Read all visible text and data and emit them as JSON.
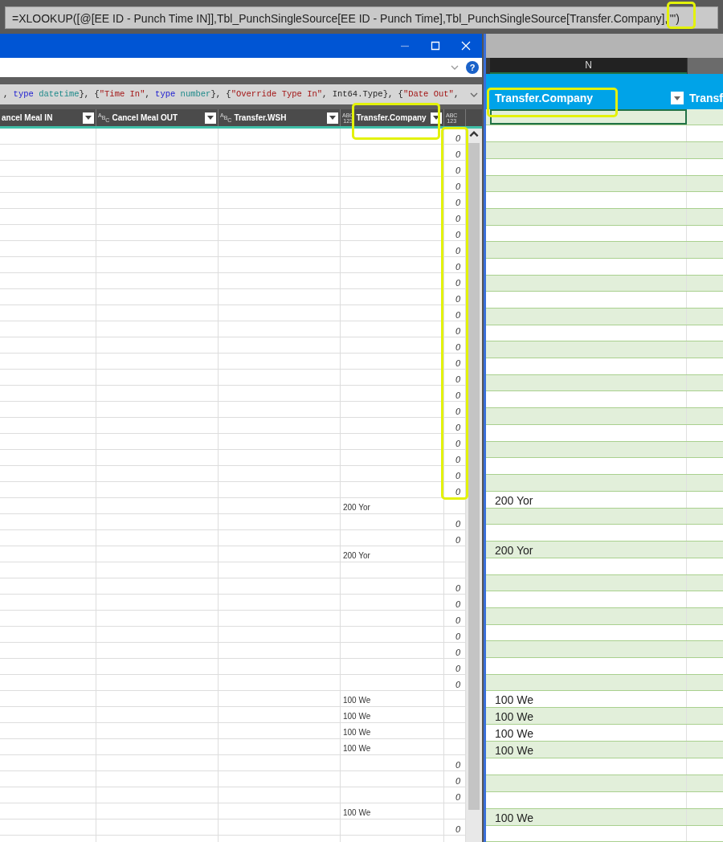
{
  "formula_bar": {
    "text": "=XLOOKUP([@[EE ID - Punch Time IN]],Tbl_PunchSingleSource[EE ID - Punch Time],Tbl_PunchSingleSource[Transfer.Company],\"\")"
  },
  "query_editor": {
    "help_glyph": "?",
    "m_code": [
      {
        "kind": "plain",
        "text": ", "
      },
      {
        "kind": "keyword",
        "text": "type"
      },
      {
        "kind": "typename",
        "text": " datetime"
      },
      {
        "kind": "plain",
        "text": "}, {"
      },
      {
        "kind": "string",
        "text": "\"Time In\""
      },
      {
        "kind": "plain",
        "text": ", "
      },
      {
        "kind": "keyword",
        "text": "type"
      },
      {
        "kind": "typename",
        "text": " number"
      },
      {
        "kind": "plain",
        "text": "}, {"
      },
      {
        "kind": "string",
        "text": "\"Override Type In\""
      },
      {
        "kind": "plain",
        "text": ", Int64.Type}, {"
      },
      {
        "kind": "string",
        "text": "\"Date Out\""
      },
      {
        "kind": "plain",
        "text": ","
      }
    ],
    "columns": [
      {
        "kind": "none",
        "label": "ancel Meal IN"
      },
      {
        "kind": "text",
        "type_icon": [
          "A",
          "B",
          "C"
        ],
        "label": "Cancel Meal OUT"
      },
      {
        "kind": "text",
        "type_icon": [
          "A",
          "B",
          "C"
        ],
        "label": "Transfer.WSH"
      },
      {
        "kind": "any",
        "type_icon": [
          "ABC",
          "123"
        ],
        "label": "Transfer.Company"
      },
      {
        "kind": "any",
        "type_icon": [
          "ABC",
          "123"
        ]
      }
    ],
    "rows": [
      {
        "value": "0"
      },
      {
        "value": "0"
      },
      {
        "value": "0"
      },
      {
        "value": "0"
      },
      {
        "value": "0"
      },
      {
        "value": "0"
      },
      {
        "value": "0"
      },
      {
        "value": "0"
      },
      {
        "value": "0"
      },
      {
        "value": "0"
      },
      {
        "value": "0"
      },
      {
        "value": "0"
      },
      {
        "value": "0"
      },
      {
        "value": "0"
      },
      {
        "value": "0"
      },
      {
        "value": "0"
      },
      {
        "value": "0"
      },
      {
        "value": "0"
      },
      {
        "value": "0"
      },
      {
        "value": "0"
      },
      {
        "value": "0"
      },
      {
        "value": "0"
      },
      {
        "value": "0"
      },
      {
        "company": "200 Yor"
      },
      {
        "value": "0"
      },
      {
        "value": "0"
      },
      {
        "company": "200 Yor"
      },
      {},
      {
        "value": "0"
      },
      {
        "value": "0"
      },
      {
        "value": "0"
      },
      {
        "value": "0"
      },
      {
        "value": "0"
      },
      {
        "value": "0"
      },
      {
        "value": "0"
      },
      {
        "company": "100 We"
      },
      {
        "company": "100 We"
      },
      {
        "company": "100 We"
      },
      {
        "company": "100 We"
      },
      {
        "value": "0"
      },
      {
        "value": "0"
      },
      {
        "value": "0"
      },
      {
        "company": "100 We"
      },
      {
        "value": "0"
      },
      {}
    ]
  },
  "sheet": {
    "column_letter": "N",
    "header": "Transfer.Company",
    "next_header": "Transf",
    "rows": [
      {
        "selected": true
      },
      {
        "selected": false
      },
      {
        "selected": false
      },
      {
        "selected": false
      },
      {
        "selected": false
      },
      {
        "selected": false
      },
      {
        "selected": false
      },
      {
        "selected": false
      },
      {
        "selected": false
      },
      {
        "selected": false
      },
      {
        "selected": false
      },
      {
        "selected": false
      },
      {
        "selected": false
      },
      {
        "selected": false
      },
      {
        "selected": false
      },
      {
        "selected": false
      },
      {
        "selected": false
      },
      {
        "selected": false
      },
      {
        "selected": false
      },
      {
        "selected": false
      },
      {
        "selected": false
      },
      {
        "selected": false
      },
      {
        "selected": false
      },
      {
        "selected": false,
        "text": "200 Yor"
      },
      {
        "selected": false
      },
      {
        "selected": false
      },
      {
        "selected": false,
        "text": "200 Yor"
      },
      {
        "selected": false
      },
      {
        "selected": false
      },
      {
        "selected": false
      },
      {
        "selected": false
      },
      {
        "selected": false
      },
      {
        "selected": false
      },
      {
        "selected": false
      },
      {
        "selected": false
      },
      {
        "selected": false,
        "text": "100 We"
      },
      {
        "selected": false,
        "text": "100 We"
      },
      {
        "selected": false,
        "text": "100 We"
      },
      {
        "selected": false,
        "text": "100 We"
      },
      {
        "selected": false
      },
      {
        "selected": false
      },
      {
        "selected": false
      },
      {
        "selected": false,
        "text": "100 We"
      },
      {
        "selected": false
      }
    ]
  },
  "annotations": [
    {
      "kind": "formula_end"
    },
    {
      "kind": "query_header"
    },
    {
      "kind": "zero_column"
    },
    {
      "kind": "sheet_header"
    }
  ]
}
